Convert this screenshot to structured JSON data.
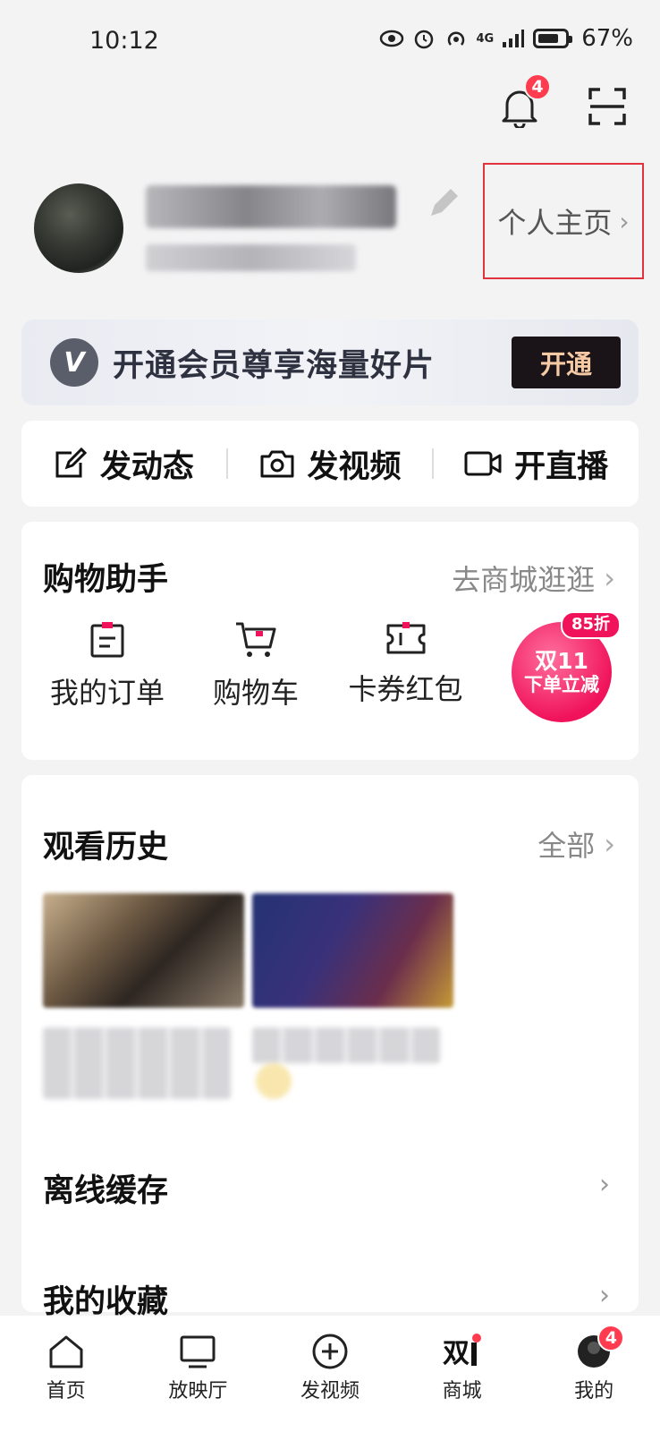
{
  "status_bar": {
    "time": "10:12",
    "network": "4G",
    "battery": "67%"
  },
  "header": {
    "notification_badge": "4"
  },
  "profile": {
    "homepage_label": "个人主页"
  },
  "vip_banner": {
    "logo_letter": "V",
    "text": "开通会员尊享海量好片",
    "button_label": "开通"
  },
  "actions": [
    {
      "label": "发动态",
      "icon": "edit-icon"
    },
    {
      "label": "发视频",
      "icon": "camera-icon"
    },
    {
      "label": "开直播",
      "icon": "video-camera-icon"
    }
  ],
  "shopping": {
    "title": "购物助手",
    "more_label": "去商城逛逛",
    "items": [
      {
        "label": "我的订单",
        "icon": "order-icon"
      },
      {
        "label": "购物车",
        "icon": "cart-icon"
      },
      {
        "label": "卡券红包",
        "icon": "coupon-icon"
      }
    ],
    "promo": {
      "line1": "双11",
      "line2": "下单立减",
      "tag": "85折"
    }
  },
  "history": {
    "title": "观看历史",
    "more_label": "全部"
  },
  "rows": [
    {
      "label": "离线缓存"
    },
    {
      "label": "我的收藏"
    }
  ],
  "bottom_nav": [
    {
      "label": "首页",
      "icon": "home-icon"
    },
    {
      "label": "放映厅",
      "icon": "tv-icon"
    },
    {
      "label": "发视频",
      "icon": "plus-circle-icon"
    },
    {
      "label": "商城",
      "icon": "double11-icon",
      "logo_text": "双"
    },
    {
      "label": "我的",
      "icon": "profile-icon",
      "badge": "4"
    }
  ],
  "colors": {
    "accent_red": "#ff3b4f",
    "highlight_box": "#e0323f",
    "vip_button_bg": "#1a1418",
    "vip_button_text": "#f6c9a5"
  }
}
